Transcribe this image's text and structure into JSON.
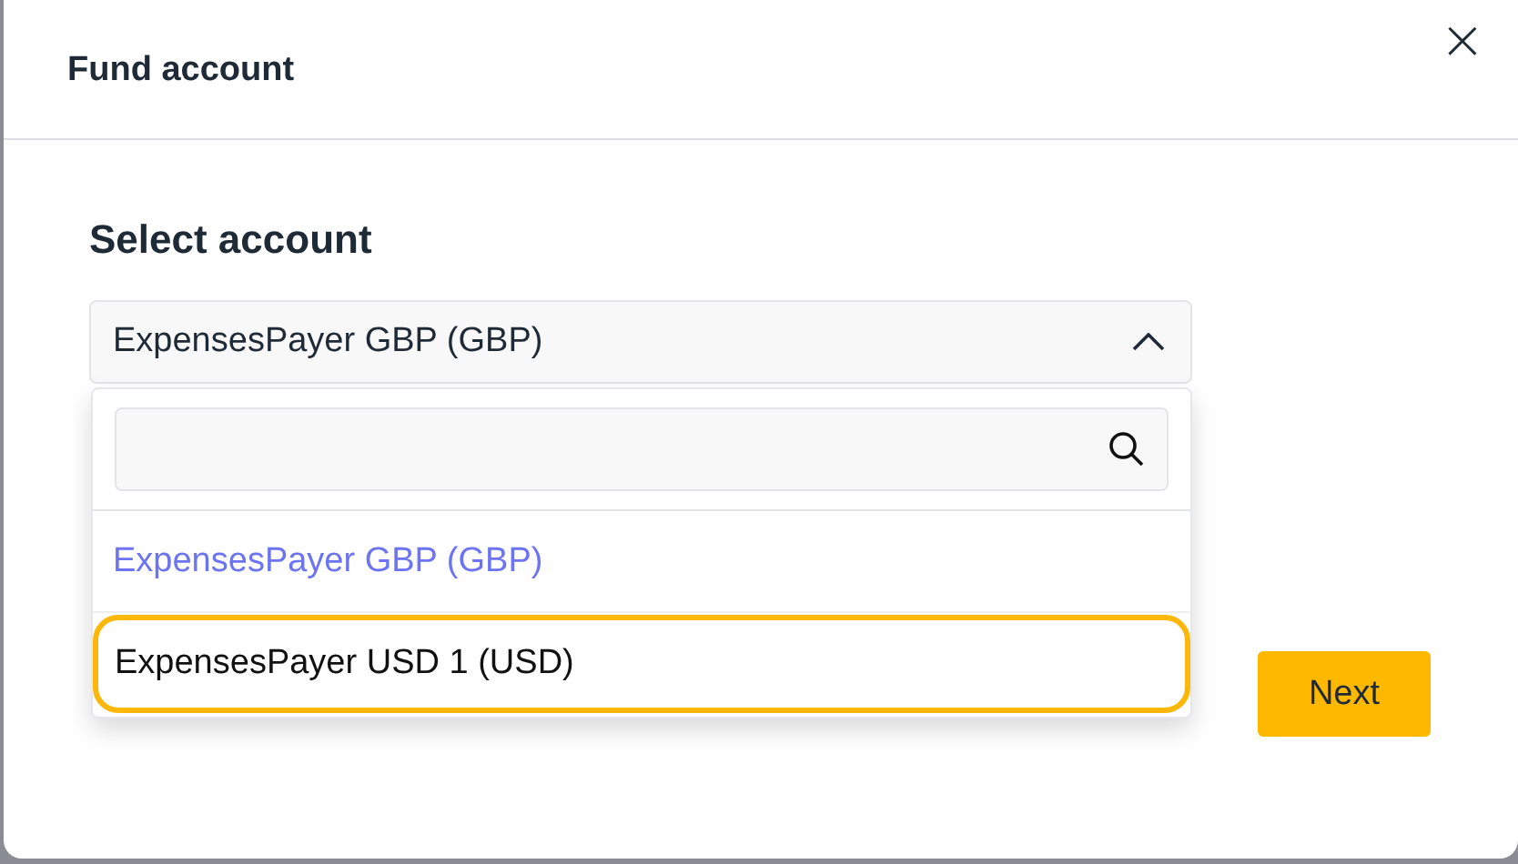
{
  "dialog": {
    "title": "Fund account",
    "close": "×"
  },
  "section_title": "Select account",
  "select": {
    "value": "ExpensesPayer GBP (GBP)",
    "expanded": true,
    "options": [
      {
        "label": "ExpensesPayer GBP (GBP)",
        "selected": true,
        "focused": false
      },
      {
        "label": "ExpensesPayer USD 1 (USD)",
        "selected": false,
        "focused": true
      }
    ]
  },
  "buttons": [
    {
      "label": "Next"
    }
  ]
}
